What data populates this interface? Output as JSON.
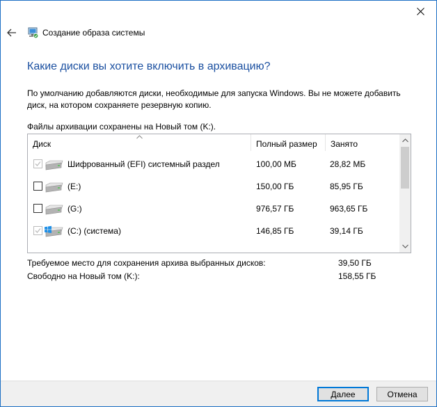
{
  "window": {
    "title": "Создание образа системы"
  },
  "heading": "Какие диски вы хотите включить в архивацию?",
  "description": "По умолчанию добавляются диски, необходимые для запуска Windows. Вы не можете добавить диск, на котором сохраняете резервную копию.",
  "saved_to": "Файлы архивации сохранены на Новый том (K:).",
  "columns": {
    "disk": "Диск",
    "total_size": "Полный размер",
    "used": "Занято"
  },
  "rows": [
    {
      "name": "Шифрованный (EFI) системный раздел",
      "total_size": "100,00 МБ",
      "used": "28,82 МБ",
      "checked": true,
      "disabled": true,
      "icon": "drive-icon"
    },
    {
      "name": "(E:)",
      "total_size": "150,00 ГБ",
      "used": "85,95 ГБ",
      "checked": false,
      "disabled": false,
      "icon": "drive-icon"
    },
    {
      "name": "(G:)",
      "total_size": "976,57 ГБ",
      "used": "963,65 ГБ",
      "checked": false,
      "disabled": false,
      "icon": "drive-icon"
    },
    {
      "name": "(C:) (система)",
      "total_size": "146,85 ГБ",
      "used": "39,14 ГБ",
      "checked": true,
      "disabled": true,
      "icon": "windows-drive-icon"
    }
  ],
  "summary": {
    "required_label": "Требуемое место для сохранения архива выбранных дисков:",
    "required_value": "39,50 ГБ",
    "free_label": "Свободно на Новый том (K:):",
    "free_value": "158,55 ГБ"
  },
  "buttons": {
    "next": "Далее",
    "cancel": "Отмена"
  },
  "colors": {
    "accent": "#0078d7",
    "heading": "#1a4fa0",
    "window_border": "#1c6fc4"
  }
}
